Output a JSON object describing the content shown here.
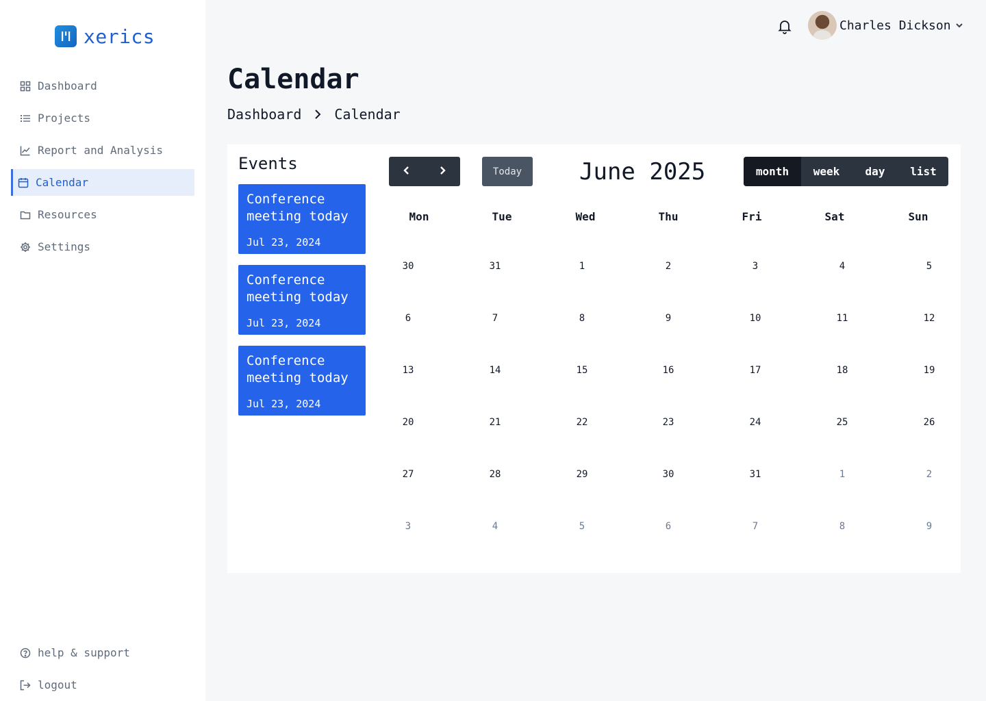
{
  "app": {
    "name": "xerics"
  },
  "sidebar": {
    "items": [
      {
        "label": "Dashboard",
        "icon": "grid-icon"
      },
      {
        "label": "Projects",
        "icon": "list-icon"
      },
      {
        "label": "Report and Analysis",
        "icon": "chart-icon"
      },
      {
        "label": "Calendar",
        "icon": "calendar-icon",
        "active": true
      },
      {
        "label": "Resources",
        "icon": "folder-icon"
      },
      {
        "label": "Settings",
        "icon": "gear-icon"
      }
    ],
    "bottom": [
      {
        "label": "help & support",
        "icon": "help-icon"
      },
      {
        "label": "logout",
        "icon": "logout-icon"
      }
    ]
  },
  "topbar": {
    "user_name": "Charles Dickson"
  },
  "header": {
    "title": "Calendar",
    "breadcrumb": [
      "Dashboard",
      "Calendar"
    ]
  },
  "events": {
    "title": "Events",
    "items": [
      {
        "title": "Conference meeting today",
        "date": "Jul 23, 2024"
      },
      {
        "title": "Conference meeting today",
        "date": "Jul 23, 2024"
      },
      {
        "title": "Conference meeting today",
        "date": "Jul 23, 2024"
      }
    ]
  },
  "calendar": {
    "today_label": "Today",
    "month_title": "June 2025",
    "views": [
      "month",
      "week",
      "day",
      "list"
    ],
    "active_view": "month",
    "weekdays": [
      "Mon",
      "Tue",
      "Wed",
      "Thu",
      "Fri",
      "Sat",
      "Sun"
    ],
    "weeks": [
      [
        {
          "d": "30",
          "m": false
        },
        {
          "d": "31",
          "m": false
        },
        {
          "d": "1",
          "m": false
        },
        {
          "d": "2",
          "m": false
        },
        {
          "d": "3",
          "m": false
        },
        {
          "d": "4",
          "m": false
        },
        {
          "d": "5",
          "m": false
        }
      ],
      [
        {
          "d": "6",
          "m": false
        },
        {
          "d": "7",
          "m": false
        },
        {
          "d": "8",
          "m": false
        },
        {
          "d": "9",
          "m": false
        },
        {
          "d": "10",
          "m": false
        },
        {
          "d": "11",
          "m": false
        },
        {
          "d": "12",
          "m": false
        }
      ],
      [
        {
          "d": "13",
          "m": false
        },
        {
          "d": "14",
          "m": false
        },
        {
          "d": "15",
          "m": false
        },
        {
          "d": "16",
          "m": false
        },
        {
          "d": "17",
          "m": false
        },
        {
          "d": "18",
          "m": false
        },
        {
          "d": "19",
          "m": false
        }
      ],
      [
        {
          "d": "20",
          "m": false
        },
        {
          "d": "21",
          "m": false
        },
        {
          "d": "22",
          "m": false
        },
        {
          "d": "23",
          "m": false
        },
        {
          "d": "24",
          "m": false
        },
        {
          "d": "25",
          "m": false
        },
        {
          "d": "26",
          "m": false
        }
      ],
      [
        {
          "d": "27",
          "m": false
        },
        {
          "d": "28",
          "m": false
        },
        {
          "d": "29",
          "m": false
        },
        {
          "d": "30",
          "m": false
        },
        {
          "d": "31",
          "m": false
        },
        {
          "d": "1",
          "m": true
        },
        {
          "d": "2",
          "m": true
        }
      ],
      [
        {
          "d": "3",
          "m": true
        },
        {
          "d": "4",
          "m": true
        },
        {
          "d": "5",
          "m": true
        },
        {
          "d": "6",
          "m": true
        },
        {
          "d": "7",
          "m": true
        },
        {
          "d": "8",
          "m": true
        },
        {
          "d": "9",
          "m": true
        }
      ]
    ]
  },
  "colors": {
    "accent": "#2563eb",
    "brand": "#1f5fcf",
    "dark_button": "#2c3440",
    "active_view": "#151a22"
  }
}
